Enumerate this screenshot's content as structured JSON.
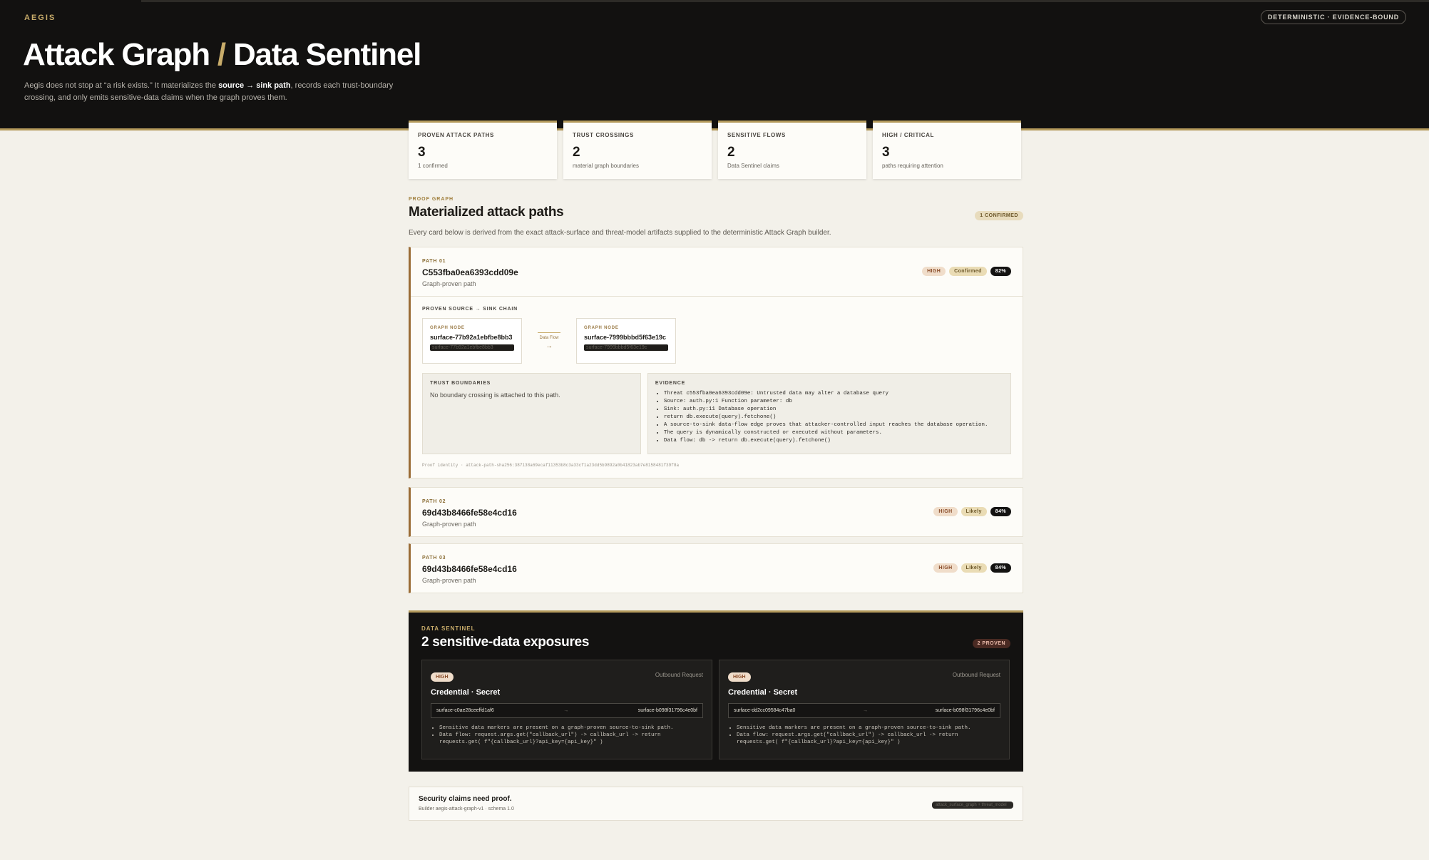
{
  "header": {
    "brand": "AEGIS",
    "badge": "DETERMINISTIC · EVIDENCE-BOUND",
    "title_left": "Attack Graph",
    "title_sep": "/",
    "title_right": "Data Sentinel",
    "sub_1": "Aegis does not stop at “a risk exists.” It materializes the ",
    "sub_bold": "source → sink path",
    "sub_2": ", records each trust-boundary crossing, and only emits sensitive-data claims when the graph proves them."
  },
  "stats": [
    {
      "label": "PROVEN ATTACK PATHS",
      "value": "3",
      "note": "1 confirmed"
    },
    {
      "label": "TRUST CROSSINGS",
      "value": "2",
      "note": "material graph boundaries"
    },
    {
      "label": "SENSITIVE FLOWS",
      "value": "2",
      "note": "Data Sentinel claims"
    },
    {
      "label": "HIGH / CRITICAL",
      "value": "3",
      "note": "paths requiring attention"
    }
  ],
  "proof": {
    "eyebrow": "PROOF GRAPH",
    "title": "Materialized attack paths",
    "pill": "1 CONFIRMED",
    "desc": "Every card below is derived from the exact attack-surface and threat-model artifacts supplied to the deterministic Attack Graph builder."
  },
  "paths": [
    {
      "num": "PATH 01",
      "id": "C553fba0ea6393cdd09e",
      "sub": "Graph-proven path",
      "severity": "HIGH",
      "status": "Confirmed",
      "score": "82%",
      "chain_label": "PROVEN SOURCE → SINK CHAIN",
      "source": {
        "label": "GRAPH NODE",
        "name": "surface-77b92a1ebfbe8bb3",
        "tag": "surface-77b92a1ebfbe8bb3"
      },
      "edge": {
        "label": "Data Flow",
        "arrow": "→"
      },
      "sink": {
        "label": "GRAPH NODE",
        "name": "surface-7999bbbd5f63e19c",
        "tag": "surface-7999bbbd5f63e19c"
      },
      "trust_label": "TRUST BOUNDARIES",
      "trust_text": "No boundary crossing is attached to this path.",
      "evidence_label": "EVIDENCE",
      "evidence": [
        "Threat c553fba0ea6393cdd09e: Untrusted data may alter a database query",
        "Source: auth.py:1 Function parameter: db",
        "Sink: auth.py:11 Database operation",
        "return db.execute(query).fetchone()",
        "A source-to-sink data-flow edge proves that attacker-controlled input reaches the database operation.",
        "The query is dynamically constructed or executed without parameters.",
        "Data flow: db -> return db.execute(query).fetchone()"
      ],
      "proof_id": "Proof identity · attack-path-sha256:387138a69ecaf11353b8c3a33cf1a23dd5b9892a0b41823ab7e8158481f39f8a"
    },
    {
      "num": "PATH 02",
      "id": "69d43b8466fe58e4cd16",
      "sub": "Graph-proven path",
      "severity": "HIGH",
      "status": "Likely",
      "score": "84%"
    },
    {
      "num": "PATH 03",
      "id": "69d43b8466fe58e4cd16",
      "sub": "Graph-proven path",
      "severity": "HIGH",
      "status": "Likely",
      "score": "84%"
    }
  ],
  "sentinel": {
    "eyebrow": "DATA SENTINEL",
    "title": "2 sensitive-data exposures",
    "pill": "2 PROVEN",
    "exposures": [
      {
        "severity": "HIGH",
        "kind": "Outbound Request",
        "title": "Credential · Secret",
        "from": "surface-c0ae28ceeffd1af6",
        "arrow": "→",
        "to": "surface-b098f31796c4e0bf",
        "bullets": [
          "Sensitive data markers are present on a graph-proven source-to-sink path.",
          "Data flow: request.args.get(\"callback_url\") -> callback_url -> return requests.get( f\"{callback_url}?api_key={api_key}\" )"
        ]
      },
      {
        "severity": "HIGH",
        "kind": "Outbound Request",
        "title": "Credential · Secret",
        "from": "surface-dd2cc09584c47ba0",
        "arrow": "→",
        "to": "surface-b098f31796c4e0bf",
        "bullets": [
          "Sensitive data markers are present on a graph-proven source-to-sink path.",
          "Data flow: request.args.get(\"callback_url\") -> callback_url -> return requests.get( f\"{callback_url}?api_key={api_key}\" )"
        ]
      }
    ]
  },
  "footer": {
    "title": "Security claims need proof.",
    "sub": "Builder aegis-attack-graph-v1 · schema 1.0",
    "tag": "attack_surface_graph + threat_model"
  },
  "colors": {
    "accent": "#b49a5c",
    "dark": "#121110",
    "paper": "#f3f1ea",
    "path_border": "#9a6c36"
  }
}
